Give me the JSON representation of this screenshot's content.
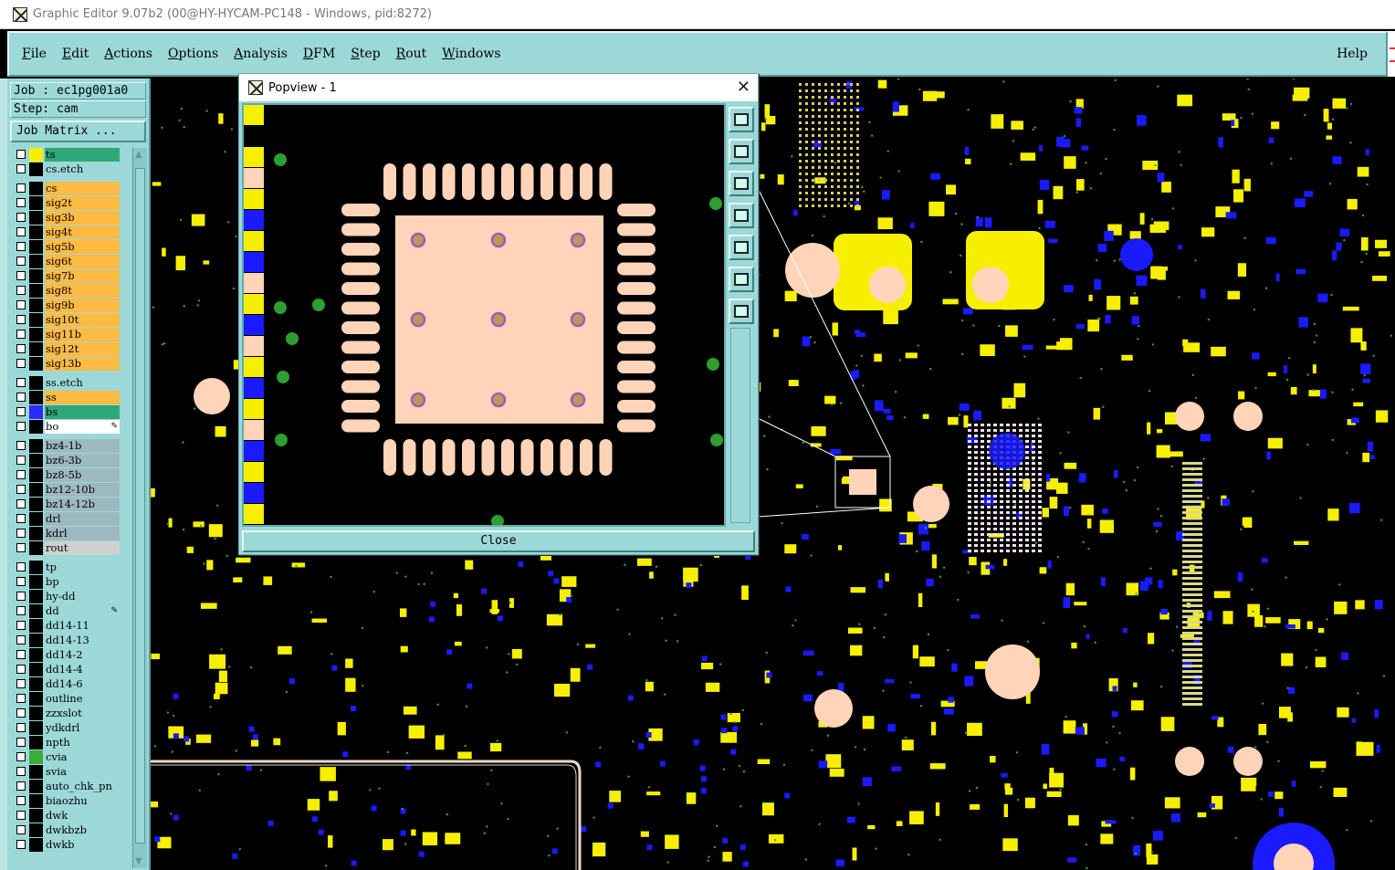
{
  "window": {
    "title": "Graphic Editor 9.07b2 (00@HY-HYCAM-PC148 - Windows, pid:8272)"
  },
  "menu": {
    "items": [
      {
        "label": "File",
        "ul": "F",
        "rest": "ile"
      },
      {
        "label": "Edit",
        "ul": "E",
        "rest": "dit"
      },
      {
        "label": "Actions",
        "ul": "A",
        "rest": "ctions"
      },
      {
        "label": "Options",
        "ul": "O",
        "rest": "ptions"
      },
      {
        "label": "Analysis",
        "ul": "A",
        "rest": "nalysis"
      },
      {
        "label": "DFM",
        "ul": "D",
        "rest": "FM"
      },
      {
        "label": "Step",
        "ul": "S",
        "rest": "tep"
      },
      {
        "label": "Rout",
        "ul": "R",
        "rest": "out"
      },
      {
        "label": "Windows",
        "ul": "W",
        "rest": "indows"
      }
    ],
    "help": "Help"
  },
  "job_info": {
    "job": "Job : ec1pg001a0",
    "step": "Step: cam",
    "job_matrix": "Job Matrix ..."
  },
  "layers": [
    {
      "name": "ts",
      "bg": "#2ea87a",
      "swatch": "#f6f000"
    },
    {
      "name": "cs.etch",
      "bg": "#9cd8d8",
      "swatch": "#000000"
    },
    {
      "name": "cs",
      "bg": "#ffbb44",
      "swatch": "#000000"
    },
    {
      "name": "sig2t",
      "bg": "#ffbb44",
      "swatch": "#000000"
    },
    {
      "name": "sig3b",
      "bg": "#ffbb44",
      "swatch": "#000000"
    },
    {
      "name": "sig4t",
      "bg": "#ffbb44",
      "swatch": "#000000"
    },
    {
      "name": "sig5b",
      "bg": "#ffbb44",
      "swatch": "#000000"
    },
    {
      "name": "sig6t",
      "bg": "#ffbb44",
      "swatch": "#000000"
    },
    {
      "name": "sig7b",
      "bg": "#ffbb44",
      "swatch": "#000000"
    },
    {
      "name": "sig8t",
      "bg": "#ffbb44",
      "swatch": "#000000"
    },
    {
      "name": "sig9b",
      "bg": "#ffbb44",
      "swatch": "#000000"
    },
    {
      "name": "sig10t",
      "bg": "#ffbb44",
      "swatch": "#000000"
    },
    {
      "name": "sig11b",
      "bg": "#ffbb44",
      "swatch": "#000000"
    },
    {
      "name": "sig12t",
      "bg": "#ffbb44",
      "swatch": "#000000"
    },
    {
      "name": "sig13b",
      "bg": "#ffbb44",
      "swatch": "#000000"
    },
    {
      "name": "ss.etch",
      "bg": "#9cd8d8",
      "swatch": "#000000"
    },
    {
      "name": "ss",
      "bg": "#ffbb44",
      "swatch": "#000000"
    },
    {
      "name": "bs",
      "bg": "#2ea87a",
      "swatch": "#2a2aff"
    },
    {
      "name": "bo",
      "bg": "#ffffff",
      "swatch": "#000000",
      "selected": true
    },
    {
      "name": "bz4-1b",
      "bg": "#9eb8c0",
      "swatch": "#000000"
    },
    {
      "name": "bz6-3b",
      "bg": "#9eb8c0",
      "swatch": "#000000"
    },
    {
      "name": "bz8-5b",
      "bg": "#9eb8c0",
      "swatch": "#000000"
    },
    {
      "name": "bz12-10b",
      "bg": "#9eb8c0",
      "swatch": "#000000"
    },
    {
      "name": "bz14-12b",
      "bg": "#9eb8c0",
      "swatch": "#000000"
    },
    {
      "name": "drl",
      "bg": "#9eb8c0",
      "swatch": "#000000"
    },
    {
      "name": "kdrl",
      "bg": "#9eb8c0",
      "swatch": "#000000"
    },
    {
      "name": "rout",
      "bg": "#d0d0d0",
      "swatch": "#000000"
    },
    {
      "name": "tp",
      "bg": "#9cd8d8",
      "swatch": "#000000"
    },
    {
      "name": "bp",
      "bg": "#9cd8d8",
      "swatch": "#000000"
    },
    {
      "name": "hy-dd",
      "bg": "#9cd8d8",
      "swatch": "#000000"
    },
    {
      "name": "dd",
      "bg": "#9cd8d8",
      "swatch": "#000000",
      "selected": true
    },
    {
      "name": "dd14-11",
      "bg": "#9cd8d8",
      "swatch": "#000000"
    },
    {
      "name": "dd14-13",
      "bg": "#9cd8d8",
      "swatch": "#000000"
    },
    {
      "name": "dd14-2",
      "bg": "#9cd8d8",
      "swatch": "#000000"
    },
    {
      "name": "dd14-4",
      "bg": "#9cd8d8",
      "swatch": "#000000"
    },
    {
      "name": "dd14-6",
      "bg": "#9cd8d8",
      "swatch": "#000000"
    },
    {
      "name": "outline",
      "bg": "#9cd8d8",
      "swatch": "#000000"
    },
    {
      "name": "zzxslot",
      "bg": "#9cd8d8",
      "swatch": "#000000"
    },
    {
      "name": "ydkdrl",
      "bg": "#9cd8d8",
      "swatch": "#000000"
    },
    {
      "name": "npth",
      "bg": "#9cd8d8",
      "swatch": "#000000"
    },
    {
      "name": "cvia",
      "bg": "#9cd8d8",
      "swatch": "#3caa3c"
    },
    {
      "name": "svia",
      "bg": "#9cd8d8",
      "swatch": "#000000"
    },
    {
      "name": "auto_chk_pn",
      "bg": "#9cd8d8",
      "swatch": "#000000"
    },
    {
      "name": "biaozhu",
      "bg": "#9cd8d8",
      "swatch": "#000000"
    },
    {
      "name": "dwk",
      "bg": "#9cd8d8",
      "swatch": "#000000"
    },
    {
      "name": "dwkbzb",
      "bg": "#9cd8d8",
      "swatch": "#000000"
    },
    {
      "name": "dwkb",
      "bg": "#9cd8d8",
      "swatch": "#000000"
    }
  ],
  "popview": {
    "title": "Popview - 1",
    "close_label": "Close",
    "tools": [
      "zoom-fit-icon",
      "pan-up-icon",
      "pan-down-icon",
      "pan-left-icon",
      "pan-right-icon",
      "zoom-in-icon",
      "zoom-out-icon"
    ]
  },
  "colors": {
    "ui_teal": "#9cd8d8",
    "pad": "#ffd4b8",
    "copper_yellow": "#f6f000",
    "copper_blue": "#1a1aff",
    "via_green": "#2e9e2e",
    "via_purple": "#b050c8"
  }
}
